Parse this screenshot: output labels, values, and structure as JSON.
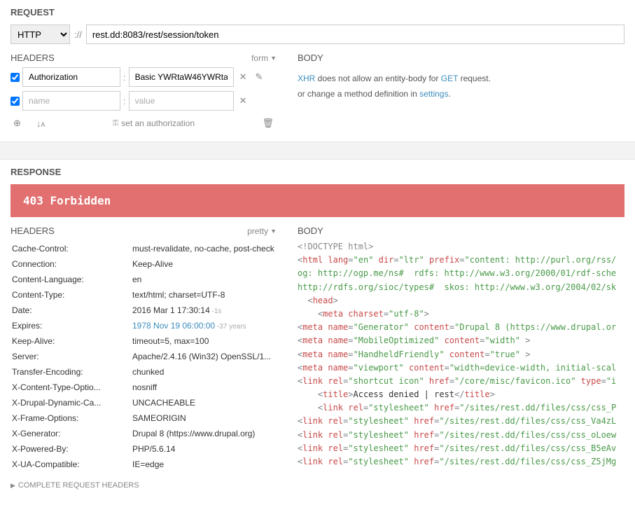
{
  "request": {
    "title": "REQUEST",
    "method": "HTTP",
    "proto": "://",
    "url": "rest.dd:8083/rest/session/token",
    "headers_title": "HEADERS",
    "form_label": "form",
    "rows": [
      {
        "checked": true,
        "name": "Authorization",
        "value": "Basic YWRtaW46YWRta"
      },
      {
        "checked": true,
        "name": "",
        "value": "",
        "name_ph": "name",
        "value_ph": "value"
      }
    ],
    "set_auth": "set an authorization",
    "body_title": "BODY",
    "body_l1_a": "XHR",
    "body_l1_b": " does not allow an entity-body for ",
    "body_l1_c": "GET",
    "body_l1_d": " request.",
    "body_l2_a": "or change a method definition in ",
    "body_l2_b": "settings",
    "body_l2_c": "."
  },
  "response": {
    "title": "RESPONSE",
    "status": "403 Forbidden",
    "headers_title": "HEADERS",
    "pretty_label": "pretty",
    "body_title": "BODY",
    "headers": [
      {
        "k": "Cache-Control:",
        "v": "must-revalidate, no-cache, post-check"
      },
      {
        "k": "Connection:",
        "v": "Keep-Alive"
      },
      {
        "k": "Content-Language:",
        "v": "en"
      },
      {
        "k": "Content-Type:",
        "v": "text/html; charset=UTF-8"
      },
      {
        "k": "Date:",
        "v": "2016 Mar 1 17:30:14",
        "note": "-1s"
      },
      {
        "k": "Expires:",
        "v": "1978 Nov 19 06:00:00",
        "note": "-37 years",
        "link": true
      },
      {
        "k": "Keep-Alive:",
        "v": "timeout=5, max=100"
      },
      {
        "k": "Server:",
        "v": "Apache/2.4.16 (Win32) OpenSSL/1..."
      },
      {
        "k": "Transfer-Encoding:",
        "v": "chunked"
      },
      {
        "k": "X-Content-Type-Optio...",
        "v": "nosniff"
      },
      {
        "k": "X-Drupal-Dynamic-Ca...",
        "v": "UNCACHEABLE"
      },
      {
        "k": "X-Frame-Options:",
        "v": "SAMEORIGIN"
      },
      {
        "k": "X-Generator:",
        "v": "Drupal 8 (https://www.drupal.org)"
      },
      {
        "k": "X-Powered-By:",
        "v": "PHP/5.6.14"
      },
      {
        "k": "X-UA-Compatible:",
        "v": "IE=edge"
      }
    ],
    "complete_headers": "COMPLETE REQUEST HEADERS",
    "body_lines": [
      [
        {
          "c": "c-gr",
          "t": "<!DOCTYPE html>"
        }
      ],
      [
        {
          "c": "c-pn",
          "t": "<"
        },
        {
          "c": "c-tag",
          "t": "html"
        },
        {
          "c": "c-txt",
          "t": " "
        },
        {
          "c": "c-attr",
          "t": "lang"
        },
        {
          "c": "c-pn",
          "t": "="
        },
        {
          "c": "c-val",
          "t": "\"en\""
        },
        {
          "c": "c-txt",
          "t": " "
        },
        {
          "c": "c-attr",
          "t": "dir"
        },
        {
          "c": "c-pn",
          "t": "="
        },
        {
          "c": "c-val",
          "t": "\"ltr\""
        },
        {
          "c": "c-txt",
          "t": " "
        },
        {
          "c": "c-attr",
          "t": "prefix"
        },
        {
          "c": "c-pn",
          "t": "="
        },
        {
          "c": "c-val",
          "t": "\"content: http://purl.org/rss/"
        }
      ],
      [
        {
          "c": "c-val",
          "t": "og: http://ogp.me/ns#  rdfs: http://www.w3.org/2000/01/rdf-sche"
        }
      ],
      [
        {
          "c": "c-val",
          "t": "http://rdfs.org/sioc/types#  skos: http://www.w3.org/2004/02/sk"
        }
      ],
      [
        {
          "c": "c-txt",
          "t": "  "
        },
        {
          "c": "c-pn",
          "t": "<"
        },
        {
          "c": "c-tag",
          "t": "head"
        },
        {
          "c": "c-pn",
          "t": ">"
        }
      ],
      [
        {
          "c": "c-txt",
          "t": "    "
        },
        {
          "c": "c-pn",
          "t": "<"
        },
        {
          "c": "c-tag",
          "t": "meta"
        },
        {
          "c": "c-txt",
          "t": " "
        },
        {
          "c": "c-attr",
          "t": "charset"
        },
        {
          "c": "c-pn",
          "t": "="
        },
        {
          "c": "c-val",
          "t": "\"utf-8\""
        },
        {
          "c": "c-pn",
          "t": ">"
        }
      ],
      [
        {
          "c": "c-pn",
          "t": "<"
        },
        {
          "c": "c-tag",
          "t": "meta"
        },
        {
          "c": "c-txt",
          "t": " "
        },
        {
          "c": "c-attr",
          "t": "name"
        },
        {
          "c": "c-pn",
          "t": "="
        },
        {
          "c": "c-val",
          "t": "\"Generator\""
        },
        {
          "c": "c-txt",
          "t": " "
        },
        {
          "c": "c-attr",
          "t": "content"
        },
        {
          "c": "c-pn",
          "t": "="
        },
        {
          "c": "c-val",
          "t": "\"Drupal 8 (https://www.drupal.or"
        }
      ],
      [
        {
          "c": "c-pn",
          "t": "<"
        },
        {
          "c": "c-tag",
          "t": "meta"
        },
        {
          "c": "c-txt",
          "t": " "
        },
        {
          "c": "c-attr",
          "t": "name"
        },
        {
          "c": "c-pn",
          "t": "="
        },
        {
          "c": "c-val",
          "t": "\"MobileOptimized\""
        },
        {
          "c": "c-txt",
          "t": " "
        },
        {
          "c": "c-attr",
          "t": "content"
        },
        {
          "c": "c-pn",
          "t": "="
        },
        {
          "c": "c-val",
          "t": "\"width\""
        },
        {
          "c": "c-txt",
          "t": " "
        },
        {
          "c": "c-pn",
          "t": ">"
        }
      ],
      [
        {
          "c": "c-pn",
          "t": "<"
        },
        {
          "c": "c-tag",
          "t": "meta"
        },
        {
          "c": "c-txt",
          "t": " "
        },
        {
          "c": "c-attr",
          "t": "name"
        },
        {
          "c": "c-pn",
          "t": "="
        },
        {
          "c": "c-val",
          "t": "\"HandheldFriendly\""
        },
        {
          "c": "c-txt",
          "t": " "
        },
        {
          "c": "c-attr",
          "t": "content"
        },
        {
          "c": "c-pn",
          "t": "="
        },
        {
          "c": "c-val",
          "t": "\"true\""
        },
        {
          "c": "c-txt",
          "t": " "
        },
        {
          "c": "c-pn",
          "t": ">"
        }
      ],
      [
        {
          "c": "c-pn",
          "t": "<"
        },
        {
          "c": "c-tag",
          "t": "meta"
        },
        {
          "c": "c-txt",
          "t": " "
        },
        {
          "c": "c-attr",
          "t": "name"
        },
        {
          "c": "c-pn",
          "t": "="
        },
        {
          "c": "c-val",
          "t": "\"viewport\""
        },
        {
          "c": "c-txt",
          "t": " "
        },
        {
          "c": "c-attr",
          "t": "content"
        },
        {
          "c": "c-pn",
          "t": "="
        },
        {
          "c": "c-val",
          "t": "\"width=device-width, initial-scal"
        }
      ],
      [
        {
          "c": "c-pn",
          "t": "<"
        },
        {
          "c": "c-tag",
          "t": "link"
        },
        {
          "c": "c-txt",
          "t": " "
        },
        {
          "c": "c-attr",
          "t": "rel"
        },
        {
          "c": "c-pn",
          "t": "="
        },
        {
          "c": "c-val",
          "t": "\"shortcut icon\""
        },
        {
          "c": "c-txt",
          "t": " "
        },
        {
          "c": "c-attr",
          "t": "href"
        },
        {
          "c": "c-pn",
          "t": "="
        },
        {
          "c": "c-val",
          "t": "\"/core/misc/favicon.ico\""
        },
        {
          "c": "c-txt",
          "t": " "
        },
        {
          "c": "c-attr",
          "t": "type"
        },
        {
          "c": "c-pn",
          "t": "="
        },
        {
          "c": "c-val",
          "t": "\"i"
        }
      ],
      [
        {
          "c": "c-txt",
          "t": ""
        }
      ],
      [
        {
          "c": "c-txt",
          "t": "    "
        },
        {
          "c": "c-pn",
          "t": "<"
        },
        {
          "c": "c-tag",
          "t": "title"
        },
        {
          "c": "c-pn",
          "t": ">"
        },
        {
          "c": "c-txt",
          "t": "Access denied | rest"
        },
        {
          "c": "c-pn",
          "t": "</"
        },
        {
          "c": "c-tag",
          "t": "title"
        },
        {
          "c": "c-pn",
          "t": ">"
        }
      ],
      [
        {
          "c": "c-txt",
          "t": "    "
        },
        {
          "c": "c-pn",
          "t": "<"
        },
        {
          "c": "c-tag",
          "t": "link"
        },
        {
          "c": "c-txt",
          "t": " "
        },
        {
          "c": "c-attr",
          "t": "rel"
        },
        {
          "c": "c-pn",
          "t": "="
        },
        {
          "c": "c-val",
          "t": "\"stylesheet\""
        },
        {
          "c": "c-txt",
          "t": " "
        },
        {
          "c": "c-attr",
          "t": "href"
        },
        {
          "c": "c-pn",
          "t": "="
        },
        {
          "c": "c-val",
          "t": "\"/sites/rest.dd/files/css/css_P"
        }
      ],
      [
        {
          "c": "c-pn",
          "t": "<"
        },
        {
          "c": "c-tag",
          "t": "link"
        },
        {
          "c": "c-txt",
          "t": " "
        },
        {
          "c": "c-attr",
          "t": "rel"
        },
        {
          "c": "c-pn",
          "t": "="
        },
        {
          "c": "c-val",
          "t": "\"stylesheet\""
        },
        {
          "c": "c-txt",
          "t": " "
        },
        {
          "c": "c-attr",
          "t": "href"
        },
        {
          "c": "c-pn",
          "t": "="
        },
        {
          "c": "c-val",
          "t": "\"/sites/rest.dd/files/css/css_Va4zL"
        }
      ],
      [
        {
          "c": "c-pn",
          "t": "<"
        },
        {
          "c": "c-tag",
          "t": "link"
        },
        {
          "c": "c-txt",
          "t": " "
        },
        {
          "c": "c-attr",
          "t": "rel"
        },
        {
          "c": "c-pn",
          "t": "="
        },
        {
          "c": "c-val",
          "t": "\"stylesheet\""
        },
        {
          "c": "c-txt",
          "t": " "
        },
        {
          "c": "c-attr",
          "t": "href"
        },
        {
          "c": "c-pn",
          "t": "="
        },
        {
          "c": "c-val",
          "t": "\"/sites/rest.dd/files/css/css_oLoew"
        }
      ],
      [
        {
          "c": "c-pn",
          "t": "<"
        },
        {
          "c": "c-tag",
          "t": "link"
        },
        {
          "c": "c-txt",
          "t": " "
        },
        {
          "c": "c-attr",
          "t": "rel"
        },
        {
          "c": "c-pn",
          "t": "="
        },
        {
          "c": "c-val",
          "t": "\"stylesheet\""
        },
        {
          "c": "c-txt",
          "t": " "
        },
        {
          "c": "c-attr",
          "t": "href"
        },
        {
          "c": "c-pn",
          "t": "="
        },
        {
          "c": "c-val",
          "t": "\"/sites/rest.dd/files/css/css_B5eAv"
        }
      ],
      [
        {
          "c": "c-pn",
          "t": "<"
        },
        {
          "c": "c-tag",
          "t": "link"
        },
        {
          "c": "c-txt",
          "t": " "
        },
        {
          "c": "c-attr",
          "t": "rel"
        },
        {
          "c": "c-pn",
          "t": "="
        },
        {
          "c": "c-val",
          "t": "\"stylesheet\""
        },
        {
          "c": "c-txt",
          "t": " "
        },
        {
          "c": "c-attr",
          "t": "href"
        },
        {
          "c": "c-pn",
          "t": "="
        },
        {
          "c": "c-val",
          "t": "\"/sites/rest.dd/files/css/css_Z5jMg"
        }
      ]
    ]
  }
}
